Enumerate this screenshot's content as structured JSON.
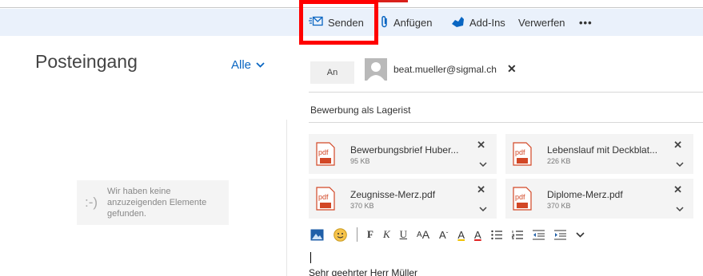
{
  "toolbar": {
    "send_label": "Senden",
    "attach_label": "Anfügen",
    "addins_label": "Add-Ins",
    "discard_label": "Verwerfen",
    "more_label": "•••"
  },
  "left_pane": {
    "folder_title": "Posteingang",
    "filter_label": "Alle",
    "empty_face": ":-)",
    "empty_message": "Wir haben keine anzuzeigenden Elemente gefunden."
  },
  "compose": {
    "to_label": "An",
    "recipient": "beat.mueller@sigmal.ch",
    "subject": "Bewerbung als Lagerist",
    "attachments": [
      {
        "name": "Bewerbungsbrief Huber...",
        "size": "95 KB"
      },
      {
        "name": "Lebenslauf mit Deckblat...",
        "size": "226 KB"
      },
      {
        "name": "Zeugnisse-Merz.pdf",
        "size": "370 KB"
      },
      {
        "name": "Diplome-Merz.pdf",
        "size": "370 KB"
      }
    ],
    "format": {
      "bold": "F",
      "italic": "K",
      "underline": "U",
      "grow": "A",
      "shrink": "A",
      "highlight": "A",
      "font_color": "A"
    },
    "body_first_line": "Sehr geehrter Herr Müller"
  },
  "colors": {
    "toolbar_bg": "#eaf1fb",
    "accent": "#0a66c2",
    "highlight_frame": "#ff0000",
    "pdf_red": "#d24726"
  }
}
